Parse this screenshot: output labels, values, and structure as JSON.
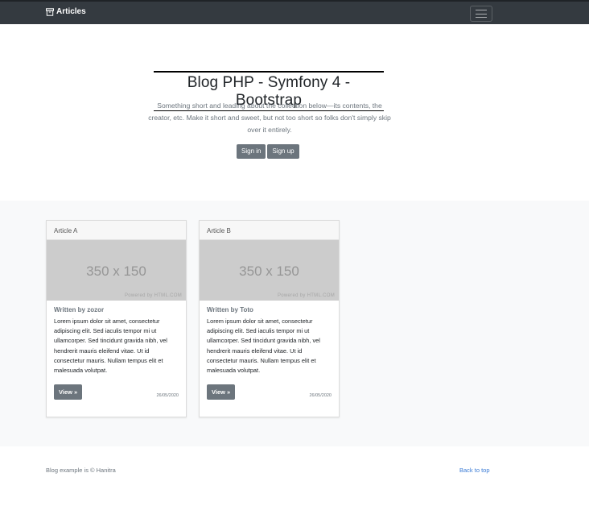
{
  "navbar": {
    "brand": "Articles",
    "brand_icon": "archive-icon",
    "toggler_icon": "hamburger-menu-icon"
  },
  "hero": {
    "title": "Blog PHP - Symfony 4 - Bootstrap",
    "lead": "Something short and leading about the collection below—its contents, the creator, etc. Make it short and sweet, but not too short so folks don't simply skip over it entirely.",
    "signin_label": "Sign in",
    "signup_label": "Sign up"
  },
  "articles": [
    {
      "header": "Article A",
      "placeholder_size": "350 x 150",
      "placeholder_powered": "Powered by HTML.COM",
      "author": "Written by zozor",
      "text": "Lorem ipsum dolor sit amet, consectetur adipiscing elit. Sed iaculis tempor mi ut ullamcorper. Sed tincidunt gravida nibh, vel hendrerit mauris eleifend vitae. Ut id consectetur mauris. Nullam tempus elit et malesuada volutpat.",
      "view_label": "View »",
      "date": "26/05/2020"
    },
    {
      "header": "Article B",
      "placeholder_size": "350 x 150",
      "placeholder_powered": "Powered by HTML.COM",
      "author": "Written by Toto",
      "text": "Lorem ipsum dolor sit amet, consectetur adipiscing elit. Sed iaculis tempor mi ut ullamcorper. Sed tincidunt gravida nibh, vel hendrerit mauris eleifend vitae. Ut id consectetur mauris. Nullam tempus elit et malesuada volutpat.",
      "view_label": "View »",
      "date": "26/05/2020"
    }
  ],
  "footer": {
    "text": "Blog example is © Hanitra",
    "back_to_top": "Back to top"
  },
  "colors": {
    "navbar": "#343a40",
    "secondary": "#6c757d",
    "album_bg": "#f8f9fa",
    "link": "#3a7bd5"
  }
}
